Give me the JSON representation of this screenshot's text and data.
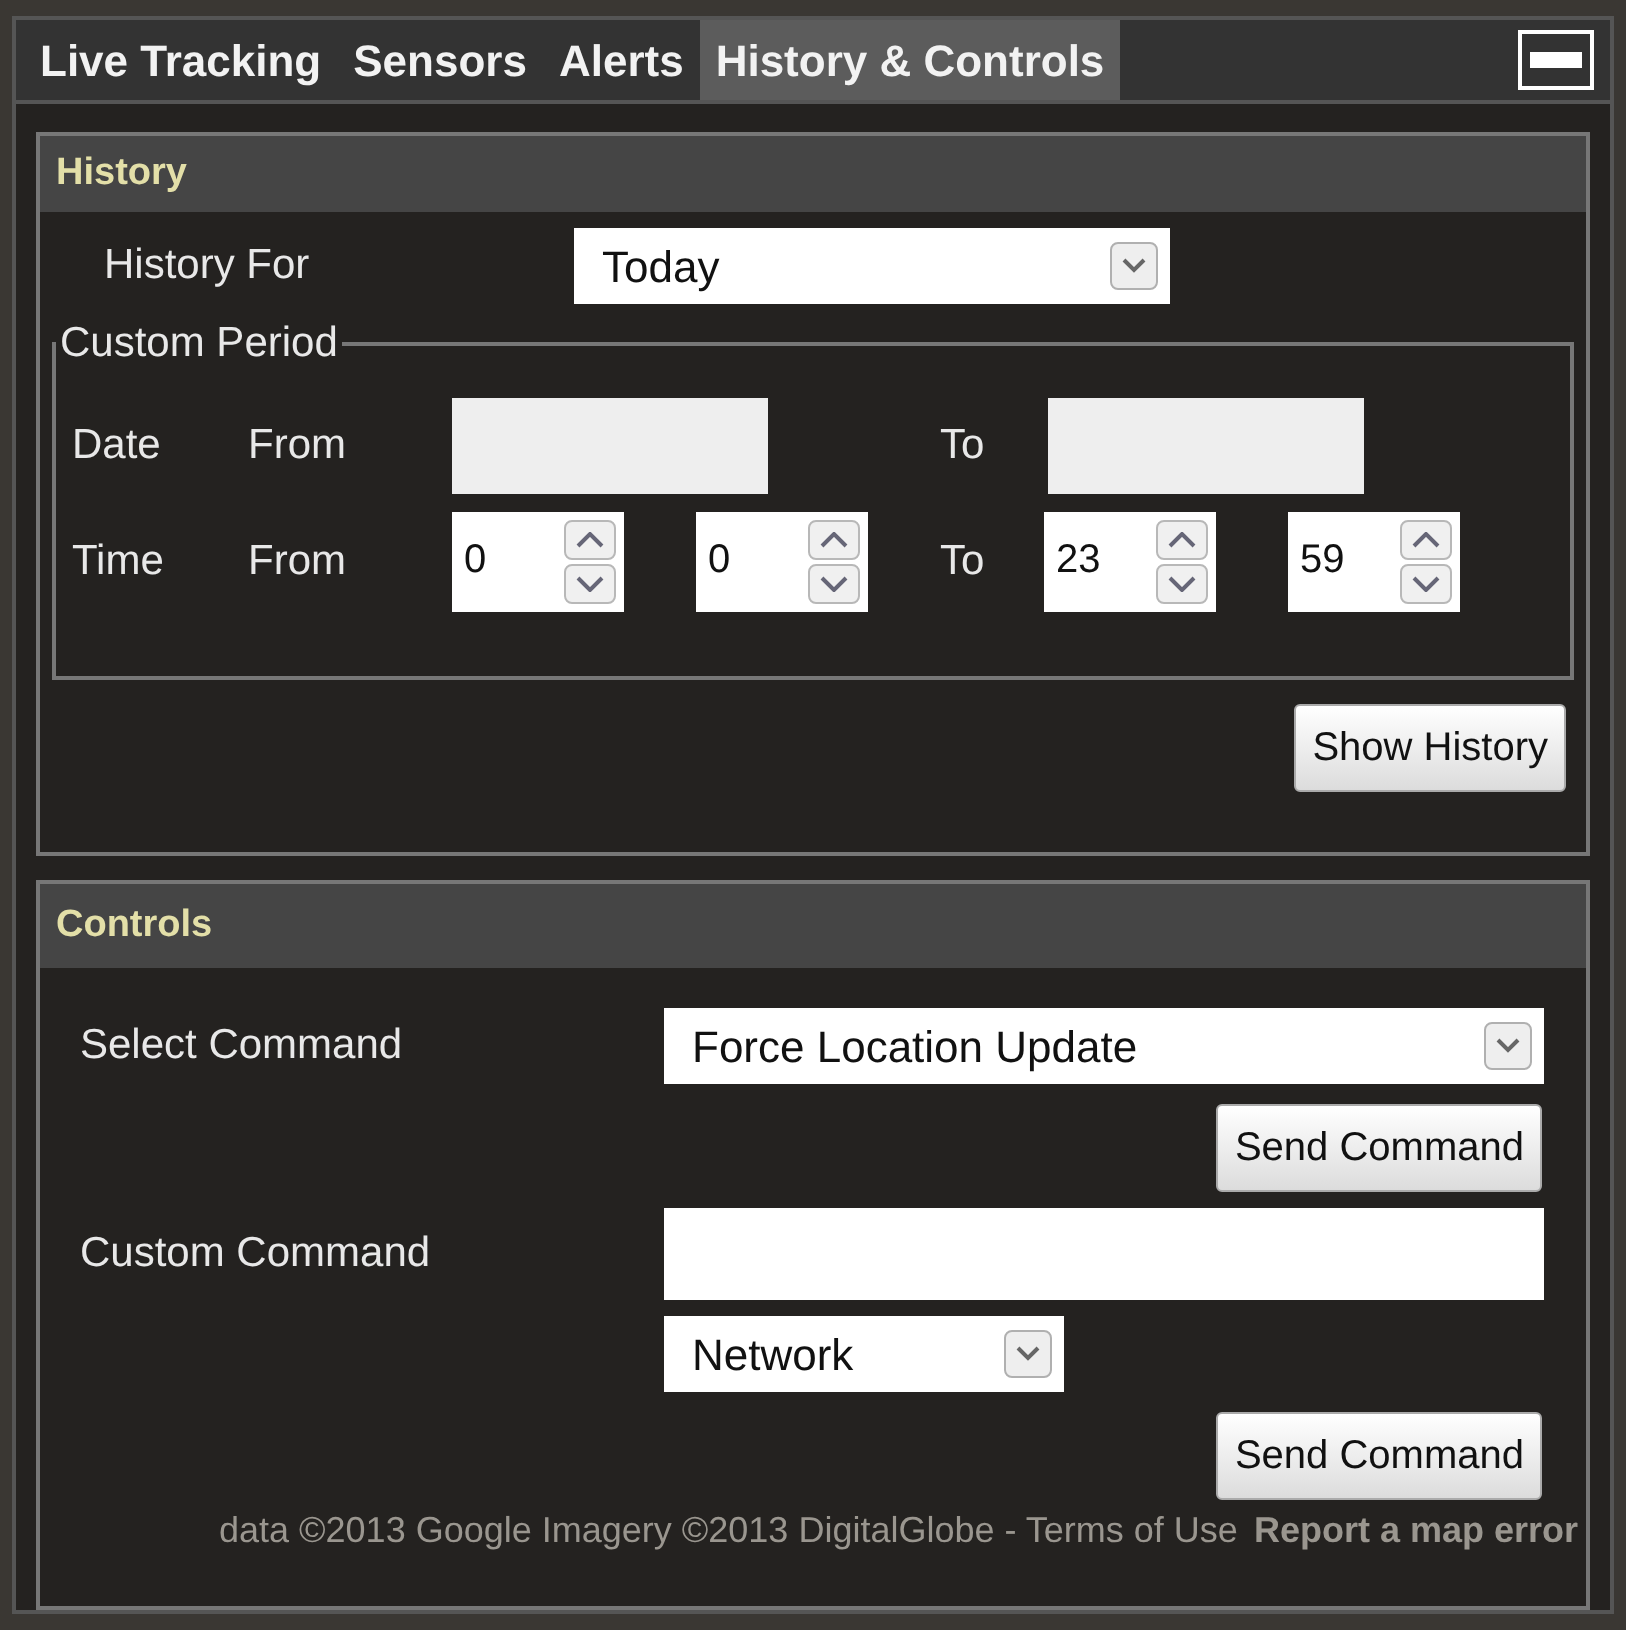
{
  "tabs": [
    {
      "label": "Live Tracking",
      "selected": false
    },
    {
      "label": "Sensors",
      "selected": false
    },
    {
      "label": "Alerts",
      "selected": false
    },
    {
      "label": "History & Controls",
      "selected": true
    }
  ],
  "history": {
    "title": "History",
    "history_for": {
      "label": "History For",
      "value": "Today"
    },
    "custom_period": {
      "legend": "Custom Period",
      "date": {
        "label": "Date",
        "from_label": "From",
        "to_label": "To"
      },
      "time": {
        "label": "Time",
        "from_label": "From",
        "to_label": "To",
        "from_hour": "0",
        "from_minute": "0",
        "to_hour": "23",
        "to_minute": "59"
      }
    },
    "button": "Show History"
  },
  "controls": {
    "title": "Controls",
    "select_command": {
      "label": "Select Command",
      "value": "Force Location Update",
      "button": "Send Command"
    },
    "custom_command": {
      "label": "Custom Command",
      "channel": "Network",
      "button": "Send Command"
    }
  },
  "map_attribution": {
    "text": "data ©2013 Google Imagery ©2013 DigitalGlobe - Terms of Use",
    "link": "Report a map error"
  }
}
